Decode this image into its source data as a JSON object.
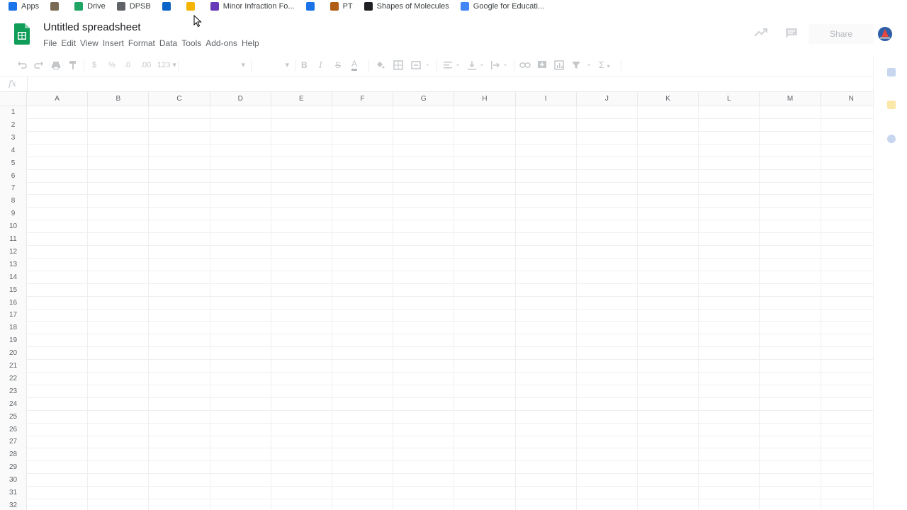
{
  "bookmarks": {
    "items": [
      {
        "label": "Apps",
        "icon": "apps-grid-icon",
        "color": "#1a73e8"
      },
      {
        "label": "",
        "icon": "tool-icon",
        "color": "#7a6a55"
      },
      {
        "label": "Drive",
        "icon": "drive-icon",
        "color": "#1fa463"
      },
      {
        "label": "DPSB",
        "icon": "document-icon",
        "color": "#5f6368"
      },
      {
        "label": "",
        "icon": "outlook-icon",
        "color": "#0a64c8"
      },
      {
        "label": "",
        "icon": "classroom-icon",
        "color": "#f4b400"
      },
      {
        "label": "Minor Infraction Fo...",
        "icon": "forms-icon",
        "color": "#673ab7"
      },
      {
        "label": "",
        "icon": "chat-icon",
        "color": "#1a73e8"
      },
      {
        "label": "PT",
        "icon": "periodic-table-icon",
        "color": "#b05d16"
      },
      {
        "label": "Shapes of Molecules",
        "icon": "chrome-icon",
        "color": "#202124"
      },
      {
        "label": "Google for Educati...",
        "icon": "google-icon",
        "color": "#4285f4"
      }
    ]
  },
  "header": {
    "title": "Untitled spreadsheet",
    "share_label": "Share",
    "brand_color": "#0f9d58"
  },
  "menu": {
    "items": [
      "File",
      "Edit",
      "View",
      "Insert",
      "Format",
      "Data",
      "Tools",
      "Add-ons",
      "Help"
    ]
  },
  "toolbar": {
    "currency": "$",
    "percent": "%",
    "decrease_decimal": ".0",
    "increase_decimal": ".00",
    "number_format": "123",
    "bold": "B",
    "italic": "I",
    "strikethrough": "S",
    "text_color": "A",
    "sum": "Σ"
  },
  "formula_bar": {
    "fx": "fx"
  },
  "grid": {
    "columns": [
      "A",
      "B",
      "C",
      "D",
      "E",
      "F",
      "G",
      "H",
      "I",
      "J",
      "K",
      "L",
      "M",
      "N"
    ],
    "rows": [
      "1",
      "2",
      "3",
      "4",
      "5",
      "6",
      "7",
      "8",
      "9",
      "10",
      "11",
      "12",
      "13",
      "14",
      "15",
      "16",
      "17",
      "18",
      "19",
      "20",
      "21",
      "22",
      "23",
      "24",
      "25",
      "26",
      "27",
      "28",
      "29",
      "30",
      "31",
      "32"
    ]
  }
}
